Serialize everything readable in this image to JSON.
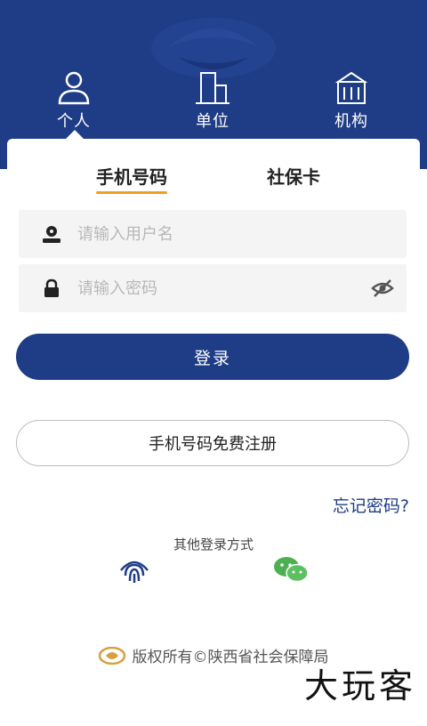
{
  "role_tabs": {
    "personal": "个人",
    "unit": "单位",
    "institution": "机构"
  },
  "login_tabs": {
    "phone": "手机号码",
    "ss_card": "社保卡"
  },
  "form": {
    "username_placeholder": "请输入用户名",
    "password_placeholder": "请输入密码"
  },
  "buttons": {
    "login": "登录",
    "register": "手机号码免费注册"
  },
  "forgot_password": "忘记密码?",
  "other_login": {
    "title": "其他登录方式",
    "methods": [
      "fingerprint-icon",
      "wechat-icon"
    ]
  },
  "footer": {
    "copyright": "版权所有©陕西省社会保障局"
  },
  "watermark": "大玩客",
  "colors": {
    "primary": "#1f3c86",
    "tab_underline": "#f0a020",
    "wechat": "#4caf50"
  }
}
